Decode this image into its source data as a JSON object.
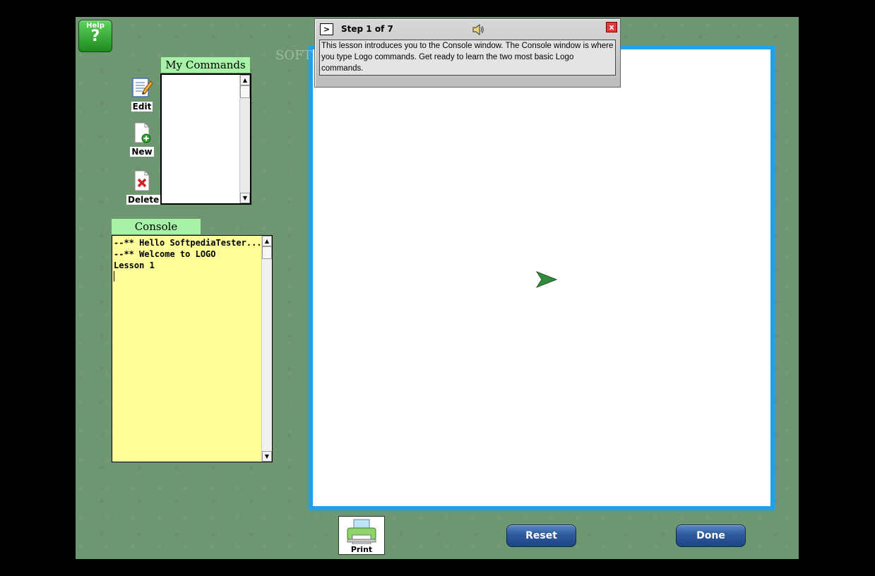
{
  "help": {
    "label": "Help",
    "glyph": "?"
  },
  "tools": {
    "edit": "Edit",
    "new": "New",
    "delete": "Delete"
  },
  "my_commands": {
    "title": "My Commands"
  },
  "console": {
    "title": "Console",
    "lines": [
      "--** Hello SoftpediaTester...",
      "--** Welcome to LOGO",
      "Lesson 1"
    ]
  },
  "lesson": {
    "next_glyph": ">",
    "step": "Step 1 of 7",
    "close_glyph": "x",
    "text": "This lesson introduces you to the Console window.  The Console window is where you type Logo commands.  Get ready to learn the two most basic Logo commands."
  },
  "watermark": "SOFTP",
  "bottom": {
    "print": "Print",
    "reset": "Reset",
    "done": "Done"
  },
  "colors": {
    "background": "#6e9670",
    "canvas_border": "#1aa3f2",
    "console_bg": "#ffff99",
    "turtle": "#2e8b3a"
  }
}
